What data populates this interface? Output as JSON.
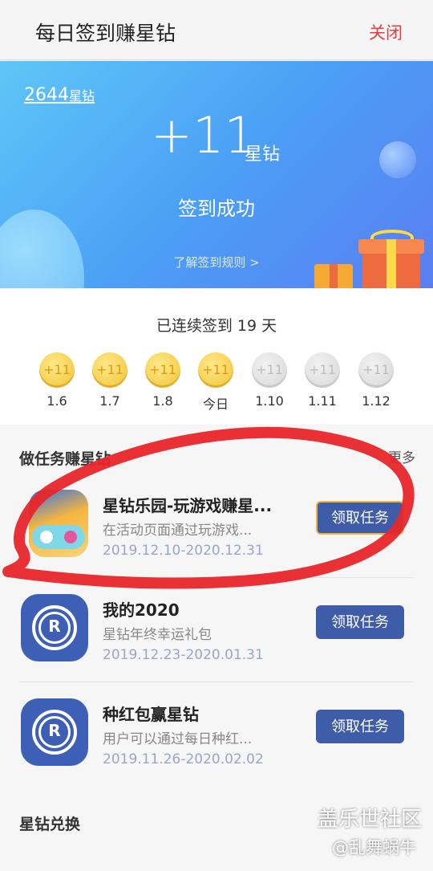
{
  "header": {
    "title": "每日签到赚星钻",
    "close_label": "关闭"
  },
  "banner": {
    "balance_value": "2644",
    "balance_unit": "星钻",
    "reward_value": "+11",
    "reward_unit": "星钻",
    "status": "签到成功",
    "rules_link": "了解签到规则 >"
  },
  "streak": {
    "text": "已连续签到 19 天"
  },
  "days": [
    {
      "amount": "+11",
      "date": "1.6",
      "state": "checked"
    },
    {
      "amount": "+11",
      "date": "1.7",
      "state": "checked"
    },
    {
      "amount": "+11",
      "date": "1.8",
      "state": "checked"
    },
    {
      "amount": "+11",
      "date": "今日",
      "state": "checked"
    },
    {
      "amount": "+11",
      "date": "1.10",
      "state": "upcoming"
    },
    {
      "amount": "+11",
      "date": "1.11",
      "state": "upcoming"
    },
    {
      "amount": "+11",
      "date": "1.12",
      "state": "upcoming"
    }
  ],
  "tasks_section": {
    "title": "做任务赚星钻",
    "more_label": "更多"
  },
  "tasks": [
    {
      "name": "星钻乐园-玩游戏赚星...",
      "desc": "在活动页面通过玩游戏...",
      "date": "2019.12.10-2020.12.31",
      "button": "领取任务",
      "icon": "game-controller-icon"
    },
    {
      "name": "我的2020",
      "desc": "星钻年终幸运礼包",
      "date": "2019.12.23-2020.01.31",
      "button": "领取任务",
      "icon": "rewards-r-icon"
    },
    {
      "name": "种红包赢星钻",
      "desc": "用户可以通过每日种红...",
      "date": "2019.11.26-2020.02.02",
      "button": "领取任务",
      "icon": "rewards-r-icon"
    }
  ],
  "exchange_section": {
    "title": "星钻兑换"
  },
  "watermark": {
    "line1": "盖乐世社区",
    "line2": "@乱舞蜗牛"
  },
  "colors": {
    "accent_red": "#e0413f",
    "button_blue": "#3e5ca8",
    "annotation_red": "#e8262a"
  }
}
